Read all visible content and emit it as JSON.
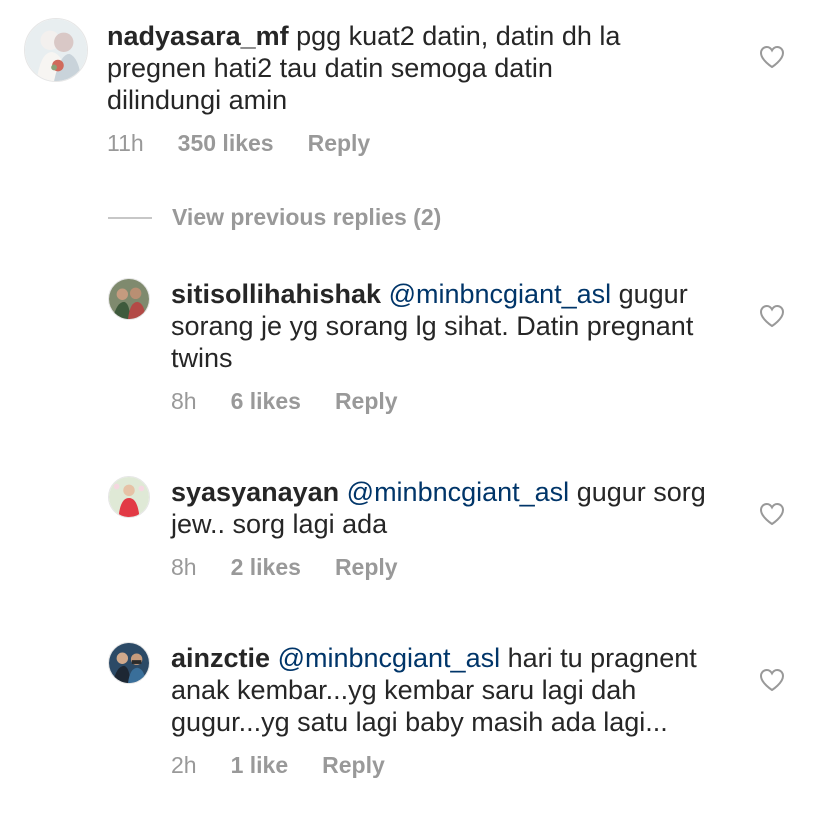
{
  "main_comment": {
    "username": "nadyasara_mf",
    "text": " pgg kuat2 datin, datin dh la pregnen hati2 tau datin semoga datin dilindungi amin",
    "time": "11h",
    "likes": "350 likes",
    "reply": "Reply"
  },
  "view_previous_replies": "View previous replies (2)",
  "replies": [
    {
      "username": "sitisollihahishak",
      "mention": "@minbncgiant_asl",
      "text": " gugur sorang je yg sorang lg sihat. Datin pregnant twins",
      "time": "8h",
      "likes": "6 likes",
      "reply": "Reply"
    },
    {
      "username": "syasyanayan",
      "mention": "@minbncgiant_asl",
      "text": " gugur sorg jew.. sorg lagi ada",
      "time": "8h",
      "likes": "2 likes",
      "reply": "Reply"
    },
    {
      "username": "ainzctie",
      "mention": "@minbncgiant_asl",
      "text": " hari tu pragnent anak kembar...yg kembar saru lagi dah gugur...yg satu lagi baby masih ada lagi...",
      "time": "2h",
      "likes": "1 like",
      "reply": "Reply"
    }
  ],
  "colors": {
    "text": "#262626",
    "meta": "#999999",
    "mention": "#003569",
    "divider": "#c7c7c7"
  },
  "icons": {
    "like": "heart-outline-icon"
  }
}
